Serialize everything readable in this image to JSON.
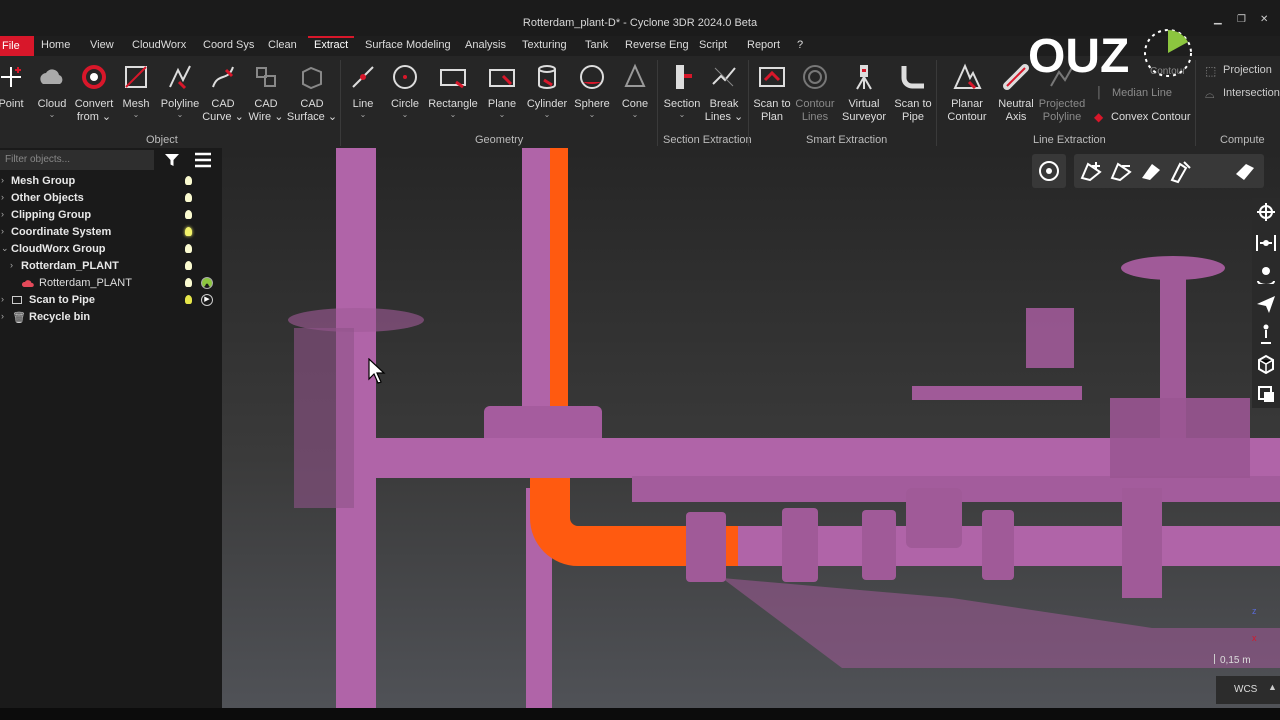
{
  "window": {
    "title": "Rotterdam_plant-D* - Cyclone 3DR 2024.0 Beta",
    "min": "▁",
    "max": "❐",
    "close": "✕"
  },
  "menu": [
    {
      "label": "File"
    },
    {
      "label": "Home"
    },
    {
      "label": "View"
    },
    {
      "label": "CloudWorx"
    },
    {
      "label": "Coord Sys"
    },
    {
      "label": "Clean"
    },
    {
      "label": "Extract"
    },
    {
      "label": "Surface Modeling"
    },
    {
      "label": "Analysis"
    },
    {
      "label": "Texturing"
    },
    {
      "label": "Tank"
    },
    {
      "label": "Reverse Eng"
    },
    {
      "label": "Script"
    },
    {
      "label": "Report"
    },
    {
      "label": "?"
    }
  ],
  "menu_active": "Extract",
  "ribbon": {
    "object": [
      {
        "l1": "Point",
        "l2": ""
      },
      {
        "l1": "Cloud",
        "l2": ""
      },
      {
        "l1": "Convert",
        "l2": "from"
      },
      {
        "l1": "Mesh",
        "l2": ""
      },
      {
        "l1": "Polyline",
        "l2": ""
      },
      {
        "l1": "CAD",
        "l2": "Curve"
      },
      {
        "l1": "CAD",
        "l2": "Wire"
      },
      {
        "l1": "CAD",
        "l2": "Surface"
      }
    ],
    "geometry": [
      {
        "l1": "Line"
      },
      {
        "l1": "Circle"
      },
      {
        "l1": "Rectangle"
      },
      {
        "l1": "Plane"
      },
      {
        "l1": "Cylinder"
      },
      {
        "l1": "Sphere"
      },
      {
        "l1": "Cone"
      }
    ],
    "section": [
      {
        "l1": "Section",
        "l2": ""
      },
      {
        "l1": "Break",
        "l2": "Lines"
      }
    ],
    "smart": [
      {
        "l1": "Scan to",
        "l2": "Plan"
      },
      {
        "l1": "Contour",
        "l2": "Lines"
      },
      {
        "l1": "Virtual",
        "l2": "Surveyor"
      },
      {
        "l1": "Scan to",
        "l2": "Pipe"
      }
    ],
    "line": [
      {
        "l1": "Planar",
        "l2": "Contour"
      },
      {
        "l1": "Neutral",
        "l2": "Axis"
      },
      {
        "l1": "Projected",
        "l2": "Polyline"
      }
    ],
    "line_side": [
      {
        "label": "Median Line"
      },
      {
        "label": "Convex Contour"
      },
      {
        "label": "Contour"
      }
    ],
    "compute_side": [
      {
        "label": "Projection"
      },
      {
        "label": "Intersection"
      }
    ],
    "groups": {
      "object": "Object",
      "geometry": "Geometry",
      "section": "Section Extraction",
      "smart": "Smart Extraction",
      "line": "Line Extraction",
      "compute": "Compute"
    }
  },
  "panel": {
    "filter_placeholder": "Filter objects...",
    "tree": [
      {
        "label": "Mesh Group"
      },
      {
        "label": "Other Objects"
      },
      {
        "label": "Clipping Group"
      },
      {
        "label": "Coordinate System"
      },
      {
        "label": "CloudWorx Group"
      },
      {
        "label": "Rotterdam_PLANT"
      },
      {
        "label": "Rotterdam_PLANT"
      },
      {
        "label": "Scan to Pipe"
      },
      {
        "label": "Recycle bin"
      }
    ]
  },
  "viewport": {
    "scale": "0,15 m",
    "coord": "WCS",
    "axis_z": "z",
    "axis_x": "x"
  },
  "badge": {
    "text": "OUZ"
  },
  "colors": {
    "accent": "#d8172a",
    "pipe": "#b064a8",
    "highlight": "#ff5a10",
    "bg": "#262626"
  }
}
